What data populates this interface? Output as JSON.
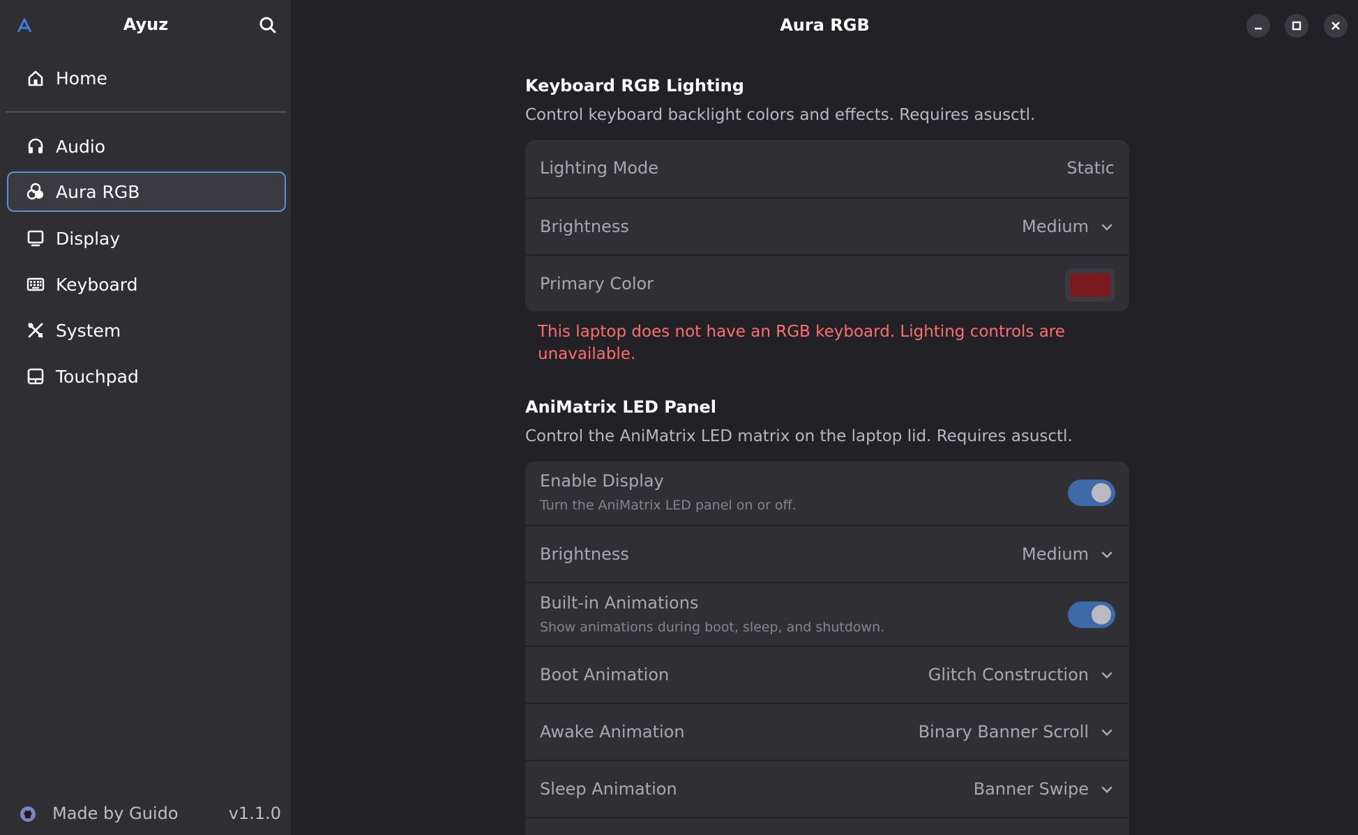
{
  "sidebar": {
    "app_title": "Ayuz",
    "home_label": "Home",
    "items": [
      {
        "label": "Audio"
      },
      {
        "label": "Aura RGB"
      },
      {
        "label": "Display"
      },
      {
        "label": "Keyboard"
      },
      {
        "label": "System"
      },
      {
        "label": "Touchpad"
      }
    ],
    "active_item": "Aura RGB",
    "footer": {
      "made_by": "Made by Guido",
      "version": "v1.1.0"
    }
  },
  "window": {
    "title": "Aura RGB"
  },
  "keyboard_section": {
    "title": "Keyboard RGB Lighting",
    "description": "Control keyboard backlight colors and effects. Requires asusctl.",
    "rows": {
      "lighting_mode": {
        "label": "Lighting Mode",
        "value": "Static"
      },
      "brightness": {
        "label": "Brightness",
        "value": "Medium"
      },
      "primary_color": {
        "label": "Primary Color",
        "color": "#7a1a1f"
      }
    },
    "error": "This laptop does not have an RGB keyboard. Lighting controls are unavailable."
  },
  "animatrix_section": {
    "title": "AniMatrix LED Panel",
    "description": "Control the AniMatrix LED matrix on the laptop lid. Requires asusctl.",
    "rows": {
      "enable_display": {
        "label": "Enable Display",
        "subtitle": "Turn the AniMatrix LED panel on or off.",
        "on": true
      },
      "brightness": {
        "label": "Brightness",
        "value": "Medium"
      },
      "builtin_animations": {
        "label": "Built-in Animations",
        "subtitle": "Show animations during boot, sleep, and shutdown.",
        "on": true
      },
      "boot_animation": {
        "label": "Boot Animation",
        "value": "Glitch Construction"
      },
      "awake_animation": {
        "label": "Awake Animation",
        "value": "Binary Banner Scroll"
      },
      "sleep_animation": {
        "label": "Sleep Animation",
        "value": "Banner Swipe"
      }
    }
  },
  "colors": {
    "accent": "#5b8fd8",
    "toggle_on": "#3d6aa8",
    "error": "#ff6e6e"
  }
}
